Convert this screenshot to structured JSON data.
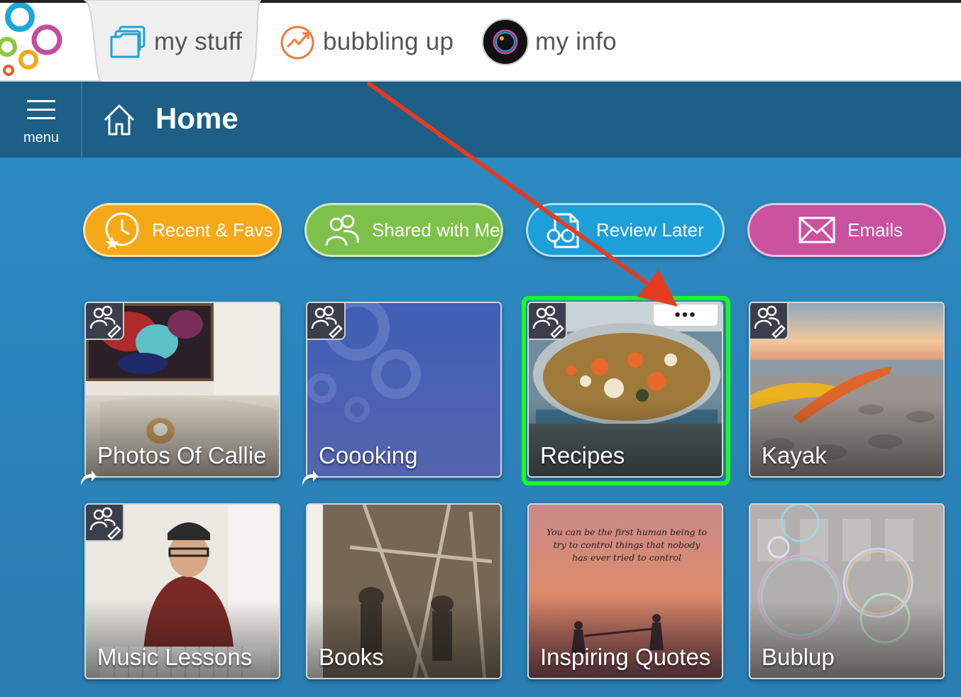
{
  "tabs": [
    {
      "label": "my stuff",
      "icon": "folders-icon",
      "active": true
    },
    {
      "label": "bubbling up",
      "icon": "trend-up-icon",
      "active": false
    },
    {
      "label": "my info",
      "icon": "avatar-icon",
      "active": false
    }
  ],
  "header": {
    "menu_label": "menu",
    "title": "Home"
  },
  "quick_buttons": [
    {
      "label": "Recent & Favs",
      "icon": "clock-star-icon",
      "color": "#f6a918"
    },
    {
      "label": "Shared with Me",
      "icon": "people-icon",
      "color": "#7dc14a"
    },
    {
      "label": "Review Later",
      "icon": "document-glasses-icon",
      "color": "#1d9fd9"
    },
    {
      "label": "Emails",
      "icon": "envelope-icon",
      "color": "#c9519e"
    }
  ],
  "cards": [
    {
      "title": "Photos Of Callie"
    },
    {
      "title": "Coooking"
    },
    {
      "title": "Recipes",
      "more_label": "•••"
    },
    {
      "title": "Kayak"
    },
    {
      "title": "Music Lessons"
    },
    {
      "title": "Books"
    },
    {
      "title": "Inspiring Quotes",
      "quote": "You can be the first human being to try to control things that nobody has ever tried to control"
    },
    {
      "title": "Bublup"
    }
  ],
  "colors": {
    "highlight": "#1aff1a",
    "annotation_arrow": "#e53b1f",
    "header_bg": "#1d5f86",
    "main_bg": "#2a86bd"
  }
}
